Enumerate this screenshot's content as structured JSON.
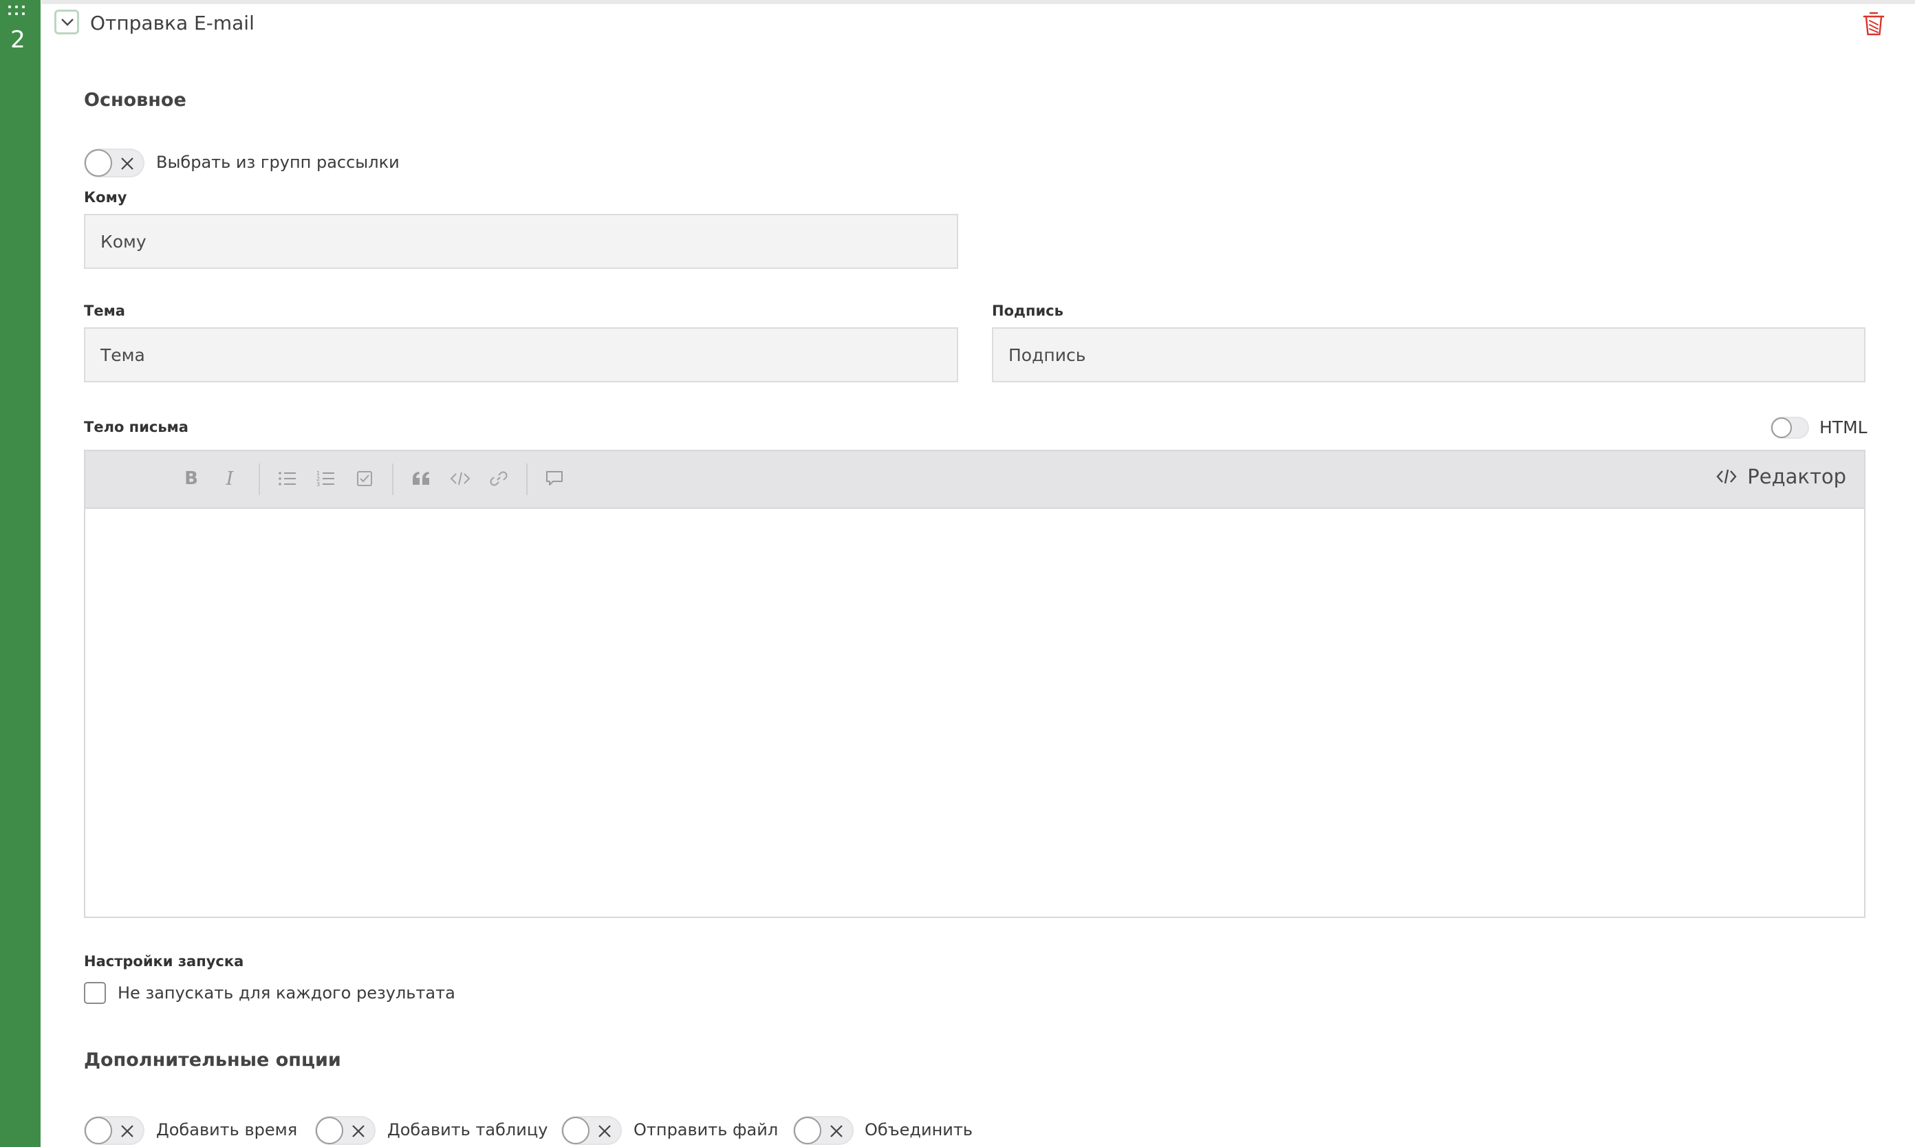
{
  "step": {
    "number": "2",
    "title": "Отправка E-mail"
  },
  "main_section": {
    "title": "Основное",
    "mailing_toggle_label": "Выбрать из групп рассылки",
    "to": {
      "label": "Кому",
      "placeholder": "Кому"
    },
    "subject": {
      "label": "Тема",
      "placeholder": "Тема"
    },
    "signature": {
      "label": "Подпись",
      "placeholder": "Подпись"
    },
    "body": {
      "label": "Тело письма",
      "html_toggle_label": "HTML",
      "toolbar": {
        "bold": "B",
        "italic": "I",
        "editor_mode_label": "Редактор"
      }
    }
  },
  "launch_settings": {
    "label": "Настройки запуска",
    "checkbox_label": "Не запускать для каждого результата"
  },
  "extra_options": {
    "title": "Дополнительные опции",
    "toggles": [
      {
        "label": "Добавить время"
      },
      {
        "label": "Добавить таблицу"
      },
      {
        "label": "Отправить файл"
      },
      {
        "label": "Объединить"
      }
    ]
  },
  "colors": {
    "sidebar": "#3f8c48",
    "delete_icon": "#d9342b",
    "input_bg": "#f3f3f4",
    "toolbar_bg": "#e4e4e6"
  },
  "icons": {
    "drag": "drag-handle-icon",
    "collapse": "chevron-down-icon",
    "delete": "trash-icon",
    "toggle_off": "close-icon"
  }
}
